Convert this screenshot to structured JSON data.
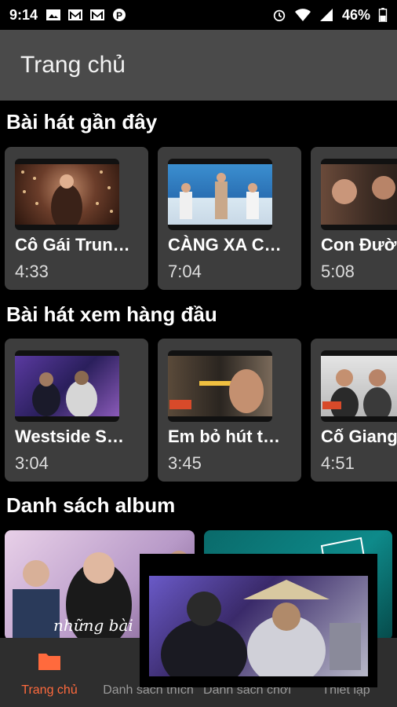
{
  "status_bar": {
    "time": "9:14",
    "battery": "46%",
    "left_icons": [
      "photo-icon",
      "gmail-icon",
      "gmail-icon",
      "p-app-icon"
    ],
    "right_icons": [
      "alarm-icon",
      "wifi-icon",
      "signal-icon",
      "battery-icon"
    ]
  },
  "app_bar": {
    "title": "Trang chủ"
  },
  "sections": {
    "recent": {
      "title": "Bài hát gần đây",
      "cards": [
        {
          "song": "Cô Gái Trun…",
          "duration": "4:33"
        },
        {
          "song": "CÀNG XA C…",
          "duration": "7:04"
        },
        {
          "song": "Con Đườ",
          "duration": "5:08"
        }
      ]
    },
    "top": {
      "title": "Bài hát xem hàng đầu",
      "cards": [
        {
          "song": "Westside S…",
          "duration": "3:04"
        },
        {
          "song": "Em bỏ hút t…",
          "duration": "3:45"
        },
        {
          "song": "Cố Giang",
          "duration": "4:51"
        }
      ]
    },
    "albums": {
      "title": "Danh sách album",
      "album_art_text": "những bài"
    }
  },
  "bottom_nav": [
    {
      "label": "Trang chủ",
      "icon": "folder-icon",
      "active": true
    },
    {
      "label": "Danh sách thích",
      "icon": "heart-icon",
      "active": false
    },
    {
      "label": "Danh sách chơi",
      "icon": "playlist-icon",
      "active": false
    },
    {
      "label": "Thiết lập",
      "icon": "settings-icon",
      "active": false
    }
  ],
  "colors": {
    "accent": "#ff6a3d",
    "app_bar": "#4a4a4a",
    "card": "#3d3d3d"
  }
}
